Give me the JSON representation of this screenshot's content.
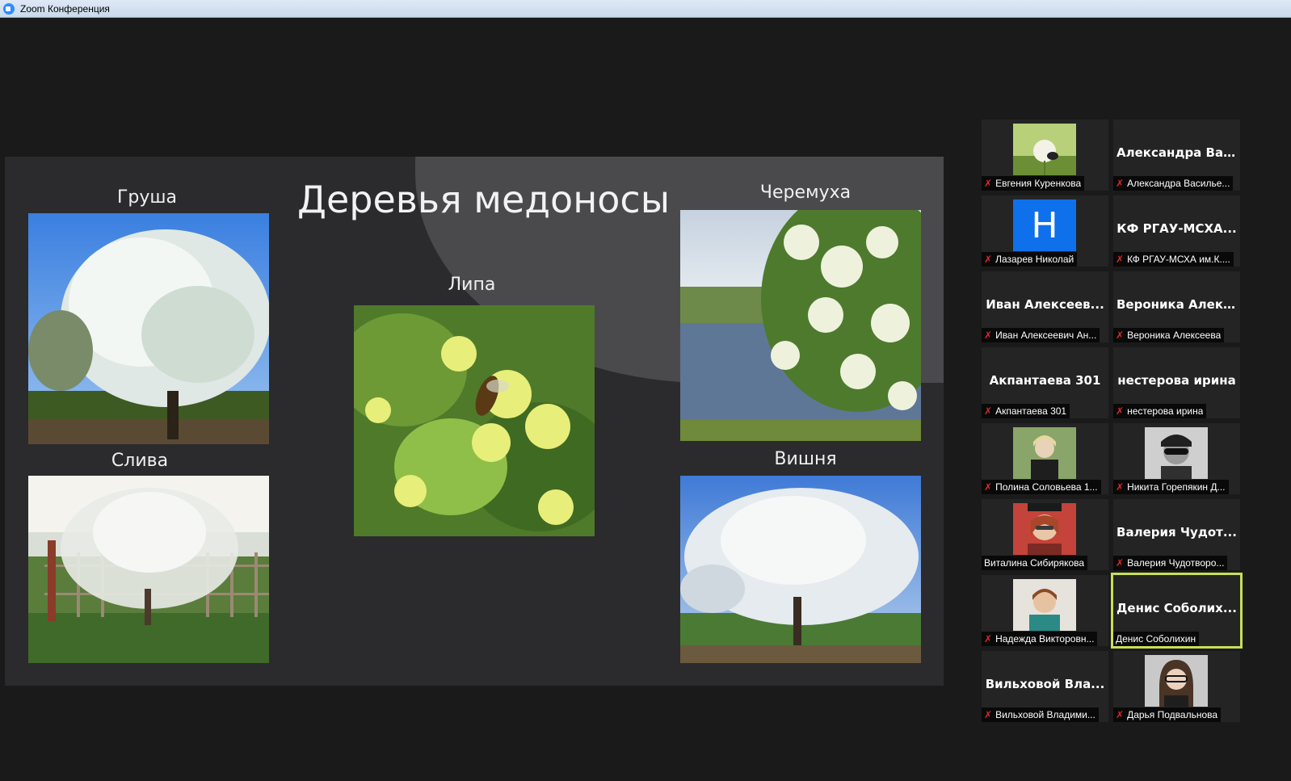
{
  "window": {
    "title": "Zoom Конференция"
  },
  "slide": {
    "title": "Деревья медоносы",
    "captions": {
      "pear": "Груша",
      "plum": "Слива",
      "linden": "Липа",
      "bird_cherry": "Черемуха",
      "cherry": "Вишня"
    }
  },
  "participants": [
    {
      "tile_name": "",
      "label": "Евгения Куренкова",
      "muted": true,
      "avatar": "flower-photo-icon"
    },
    {
      "tile_name": "Александра Ва...",
      "label": "Александра Василье...",
      "muted": true
    },
    {
      "tile_name": "",
      "label": "Лазарев Николай",
      "muted": true,
      "avatar_letter": "Н"
    },
    {
      "tile_name": "КФ РГАУ-МСХА...",
      "label": "КФ РГАУ-МСХА им.К....",
      "muted": true
    },
    {
      "tile_name": "Иван Алексеев...",
      "label": "Иван Алексеевич Ан...",
      "muted": true
    },
    {
      "tile_name": "Вероника Алек...",
      "label": "Вероника Алексеева",
      "muted": true
    },
    {
      "tile_name": "Акпантаева 301",
      "label": "Акпантаева 301",
      "muted": true
    },
    {
      "tile_name": "нестерова ирина",
      "label": "нестерова ирина",
      "muted": true
    },
    {
      "tile_name": "",
      "label": "Полина Соловьева 1...",
      "muted": true,
      "avatar": "person-photo-icon"
    },
    {
      "tile_name": "",
      "label": "Никита Горепякин Д...",
      "muted": true,
      "avatar": "person-photo-icon"
    },
    {
      "tile_name": "",
      "label": "Виталина Сибирякова",
      "muted": false,
      "avatar": "person-photo-icon"
    },
    {
      "tile_name": "Валерия Чудот...",
      "label": "Валерия Чудотворо...",
      "muted": true
    },
    {
      "tile_name": "",
      "label": "Надежда Викторовн...",
      "muted": true,
      "avatar": "person-photo-icon"
    },
    {
      "tile_name": "Денис Соболих...",
      "label": "Денис Соболихин",
      "muted": false,
      "active": true
    },
    {
      "tile_name": "Вильховой Вла...",
      "label": "Вильховой Владими...",
      "muted": true
    },
    {
      "tile_name": "",
      "label": "Дарья Подвальнова",
      "muted": true,
      "avatar": "person-photo-icon"
    }
  ],
  "colors": {
    "active_speaker": "#c6e055",
    "muted_mic": "#e02828",
    "avatar_blue": "#0e71eb"
  }
}
